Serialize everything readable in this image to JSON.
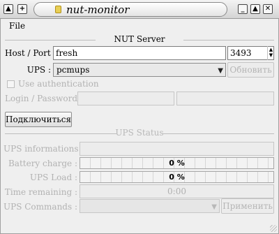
{
  "window": {
    "title": "nut-monitor"
  },
  "titlebar": {
    "left_buttons": [
      {
        "icon": "arrow-up-icon",
        "glyph": "▲"
      },
      {
        "icon": "add-icon",
        "glyph": "+"
      }
    ],
    "right_buttons": [
      {
        "icon": "minimize-icon",
        "glyph": "_"
      },
      {
        "icon": "maximize-icon",
        "glyph": "▲"
      },
      {
        "icon": "close-icon",
        "glyph": "✕"
      }
    ]
  },
  "menu": {
    "items": [
      "File"
    ]
  },
  "server": {
    "section_title": "NUT Server",
    "host_port_label": "Host / Port :",
    "host_value": "fresh",
    "port_value": "3493",
    "ups_label": "UPS :",
    "ups_selected": "pcmups",
    "refresh_button": "Обновить",
    "use_auth_label": "Use authentication",
    "login_password_label": "Login / Password :",
    "login_value": "",
    "password_value": "",
    "connect_button": "Подключиться"
  },
  "status": {
    "section_title": "UPS Status",
    "info_label": "UPS informations :",
    "info_value": "",
    "battery_label": "Battery charge :",
    "battery_text": "0 %",
    "battery_percent": 0,
    "load_label": "UPS Load :",
    "load_text": "0 %",
    "load_percent": 0,
    "time_label": "Time remaining :",
    "time_value": "0:00",
    "commands_label": "UPS Commands :",
    "apply_button": "Применить"
  }
}
